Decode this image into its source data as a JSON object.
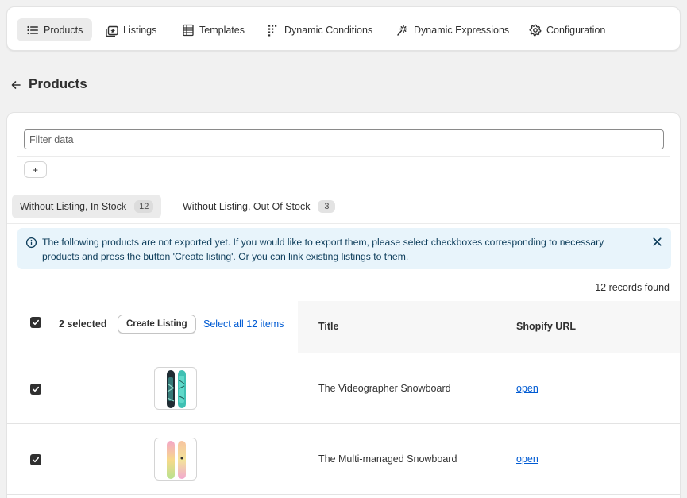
{
  "nav": {
    "items": [
      {
        "label": "Products",
        "icon": "list-icon",
        "active": true
      },
      {
        "label": "Listings",
        "icon": "listings-icon",
        "active": false
      },
      {
        "label": "Templates",
        "icon": "templates-icon",
        "active": false
      },
      {
        "label": "Dynamic Conditions",
        "icon": "conditions-icon",
        "active": false
      },
      {
        "label": "Dynamic Expressions",
        "icon": "sparkle-icon",
        "active": false
      },
      {
        "label": "Configuration",
        "icon": "gear-icon",
        "active": false
      }
    ]
  },
  "page": {
    "title": "Products"
  },
  "filter": {
    "placeholder": "Filter data",
    "value": "",
    "add_label": "+"
  },
  "tabs": [
    {
      "label": "Without Listing, In Stock",
      "count": "12",
      "active": true
    },
    {
      "label": "Without Listing, Out Of Stock",
      "count": "3",
      "active": false
    }
  ],
  "banner": {
    "text": "The following products are not exported yet. If you would like to export them, please select checkboxes corresponding to necessary products and press the button 'Create listing'. Or you can link existing listings to them.",
    "color": "#e8f4fb"
  },
  "records": {
    "text": "12 records found"
  },
  "table": {
    "selected_text": "2 selected",
    "create_button": "Create Listing",
    "select_all": "Select all 12 items",
    "columns": [
      "Title",
      "Shopify URL"
    ],
    "rows": [
      {
        "title": "The Videographer Snowboard",
        "url_label": "open",
        "checked": true
      },
      {
        "title": "The Multi-managed Snowboard",
        "url_label": "open",
        "checked": true
      }
    ]
  },
  "colors": {
    "accent": "#005bd3",
    "page_bg": "#f1f1f1",
    "checkbox": "#303030"
  }
}
